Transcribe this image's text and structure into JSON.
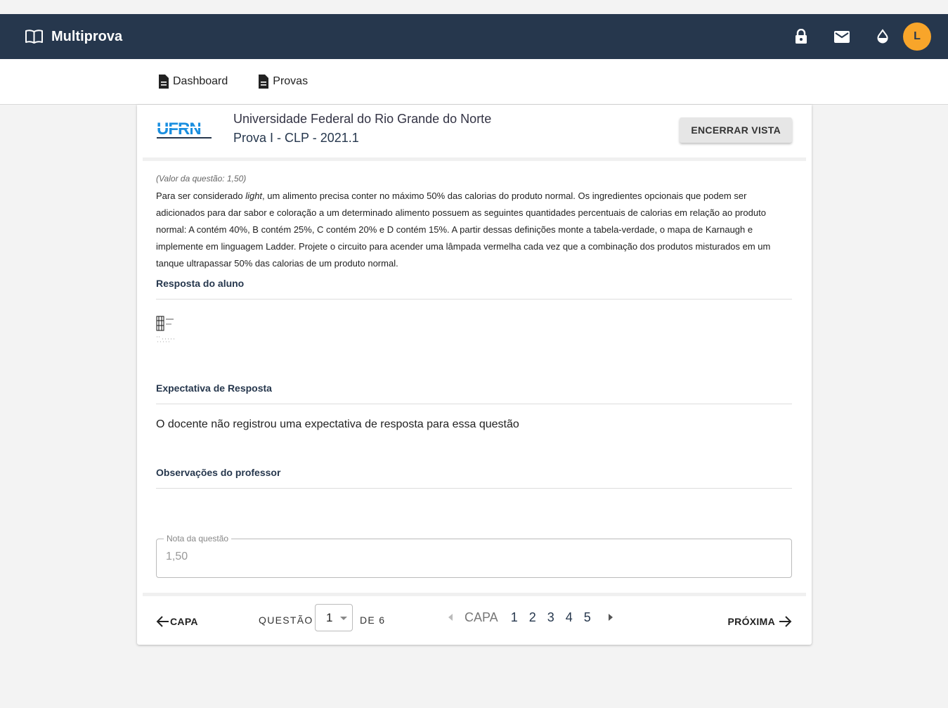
{
  "app": {
    "title": "Multiprova",
    "avatar_letter": "L"
  },
  "nav": {
    "dashboard": "Dashboard",
    "provas": "Provas"
  },
  "header": {
    "logo_text": "UFRN",
    "institution": "Universidade Federal do Rio Grande do Norte",
    "exam": "Prova I - CLP - 2021.1",
    "end_button": "ENCERRAR VISTA"
  },
  "question": {
    "value_label": "(Valor da questão: 1,50)",
    "text_before": "Para ser considerado ",
    "text_emph": "light",
    "text_after": ", um alimento precisa conter no máximo 50% das calorias do produto normal. Os ingredientes opcionais que podem ser adicionados para dar sabor e coloração a um determinado alimento possuem as seguintes quantidades percentuais de calorias em relação ao produto normal: A contém 40%, B contém 25%, C contém 20% e D contém 15%. A partir dessas definições monte a tabela-verdade, o mapa de Karnaugh e implemente em linguagem Ladder. Projete o circuito para acender uma lâmpada vermelha cada vez que a combinação dos produtos misturados em um tanque ultrapassar 50% das calorias de um produto normal."
  },
  "sections": {
    "student_answer": "Resposta do aluno",
    "expected_answer": "Expectativa de Resposta",
    "expected_text": "O docente não registrou uma expectativa de resposta para essa questão",
    "observations": "Observações do professor"
  },
  "grade": {
    "label": "Nota da questão",
    "value": "1,50"
  },
  "footer": {
    "back": "CAPA",
    "question_label": "QUESTÃO",
    "current": "1",
    "of_label": "DE 6",
    "pager_capa": "CAPA",
    "pages": [
      "1",
      "2",
      "3",
      "4",
      "5"
    ],
    "next": "PRÓXIMA"
  },
  "colors": {
    "topbar": "#26374d",
    "avatar": "#f8a52a",
    "logo_blue": "#1a8fe0"
  }
}
